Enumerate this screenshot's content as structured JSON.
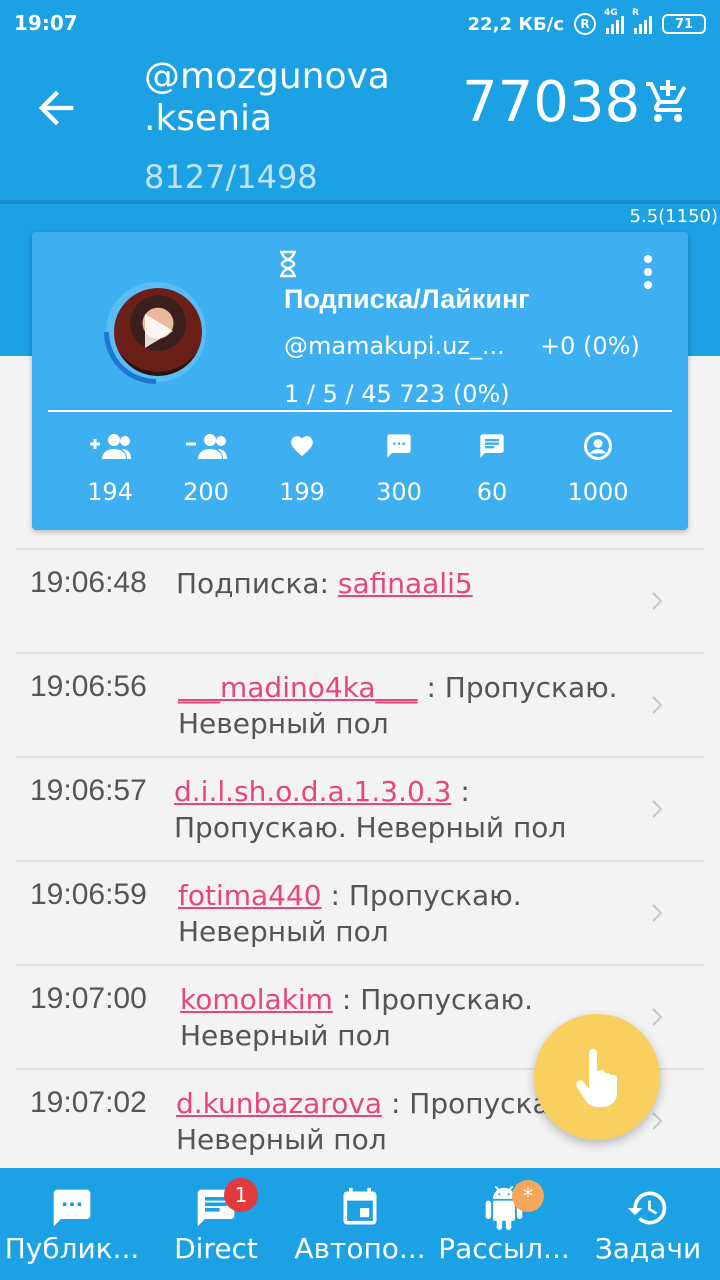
{
  "status_bar": {
    "time": "19:07",
    "speed": "22,2 КБ/с",
    "r_icon": "R",
    "network_4g": "4G",
    "roaming_r": "R",
    "battery": "71"
  },
  "header": {
    "account_line1": "@mozgunova",
    "account_line2": ".ksenia",
    "counts": "8127/1498",
    "balance": "77038",
    "version": "5.5(1150)"
  },
  "task_card": {
    "title": "Подписка/Лайкинг",
    "account": "@mamakupi.uz_...",
    "delta": "+0 (0%)",
    "progress": "1 / 5 / 45 723 (0%)",
    "stats": [
      {
        "icon": "follow-add-icon",
        "value": "194"
      },
      {
        "icon": "unfollow-icon",
        "value": "200"
      },
      {
        "icon": "heart-icon",
        "value": "199"
      },
      {
        "icon": "comment-dots-icon",
        "value": "300"
      },
      {
        "icon": "message-lines-icon",
        "value": "60"
      },
      {
        "icon": "account-circle-icon",
        "value": "1000"
      }
    ]
  },
  "log": [
    {
      "time": "19:06:48",
      "prefix": "Подписка: ",
      "user": "safinaali5",
      "suffix": ""
    },
    {
      "time": "19:06:56",
      "prefix": "",
      "user": "___madino4ka___",
      "suffix": " : Пропускаю. Неверный пол"
    },
    {
      "time": "19:06:57",
      "prefix": "",
      "user": "d.i.l.sh.o.d.a.1.3.0.3",
      "suffix": " : Пропускаю. Неверный пол"
    },
    {
      "time": "19:06:59",
      "prefix": "",
      "user": "fotima440",
      "suffix": " : Пропускаю. Неверный пол"
    },
    {
      "time": "19:07:00",
      "prefix": "",
      "user": "komolakim",
      "suffix": " : Пропускаю. Неверный пол"
    },
    {
      "time": "19:07:02",
      "prefix": "",
      "user": "d.kunbazarova",
      "suffix": " : Пропускаю. Неверный пол"
    }
  ],
  "bottom_nav": [
    {
      "label": "Публик...",
      "icon": "chat-bubble-icon",
      "badge": ""
    },
    {
      "label": "Direct",
      "icon": "message-icon",
      "badge": "1"
    },
    {
      "label": "Автопо...",
      "icon": "calendar-icon",
      "badge": ""
    },
    {
      "label": "Рассыл...",
      "icon": "android-icon",
      "badge": "*"
    },
    {
      "label": "Задачи",
      "icon": "history-icon",
      "badge": ""
    }
  ],
  "colors": {
    "primary": "#1ba1e4",
    "card": "#3eb0f1",
    "link": "#e6477a",
    "fab": "#f8d060",
    "badge_red": "#e33b3b",
    "badge_orange": "#f4a65a"
  }
}
